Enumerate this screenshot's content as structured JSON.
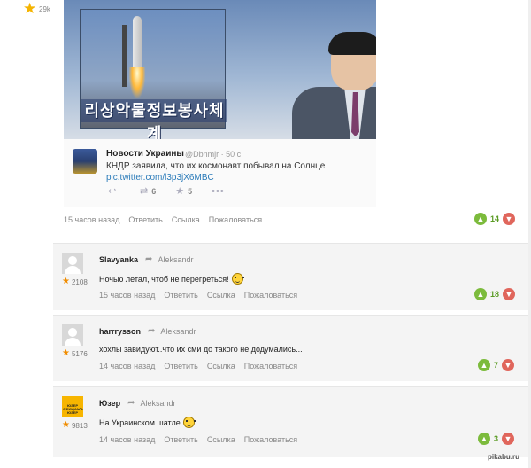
{
  "top_rating": {
    "count": "29k"
  },
  "tweet": {
    "author": "Новости Украины",
    "handle": "@Dbnmjr · 50 с",
    "text": "КНДР заявила, что их космонавт побывал на Солнце",
    "link": "pic.twitter.com/l3p3jX6MBC",
    "retweets": "6",
    "favorites": "5",
    "banner_text": "리상악물정보봉사체계"
  },
  "post": {
    "time": "15 часов назад",
    "reply": "Ответить",
    "link": "Ссылка",
    "complain": "Пожаловаться",
    "votes": "14"
  },
  "comments": [
    {
      "author": "Slavyanka",
      "reply_to": "Aleksandr",
      "rating": "2108",
      "text": "Ночью летал, чтоб не перегреться!",
      "time": "15 часов назад",
      "reply": "Ответить",
      "link": "Ссылка",
      "complain": "Пожаловаться",
      "votes": "18"
    },
    {
      "author": "harrrysson",
      "reply_to": "Aleksandr",
      "rating": "5176",
      "text": "хохлы завидуют..что их сми до такого не додумались...",
      "time": "14 часов назад",
      "reply": "Ответить",
      "link": "Ссылка",
      "complain": "Пожаловаться",
      "votes": "7"
    },
    {
      "author": "Юзер",
      "reply_to": "Aleksandr",
      "rating": "9813",
      "text": "На Украинском шатле",
      "time": "14 часов назад",
      "reply": "Ответить",
      "link": "Ссылка",
      "complain": "Пожаловаться",
      "votes": "3",
      "avatar_text": "ЮЗЕР ОФИЦИАЛЬНЫЙ ЮЗЕР"
    }
  ],
  "watermark": "pikabu.ru",
  "colors": {
    "vote_up": "#7cbb3c",
    "vote_down": "#e0665c",
    "star": "#f08c00",
    "link": "#2b7bb9"
  },
  "icons": {
    "rating": "star-icon",
    "reply_arrow": "reply-arrow-icon",
    "vote_up": "thumb-up-icon",
    "vote_down": "thumb-down-icon",
    "smiley": "smiley-icon"
  }
}
